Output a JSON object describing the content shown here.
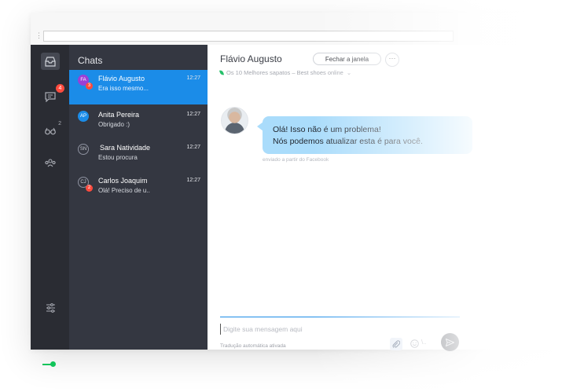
{
  "app": {
    "more_menu_glyph": "⋮"
  },
  "rail": {
    "items": [
      {
        "icon": "inbox-icon",
        "active": true
      },
      {
        "icon": "chat-bubble-icon",
        "badge": "4"
      },
      {
        "icon": "visitors-icon",
        "superscript": "2"
      },
      {
        "icon": "team-icon"
      },
      {
        "icon": "settings-sliders-icon"
      }
    ],
    "status_color": "#12c45a"
  },
  "chatlist": {
    "title": "Chats",
    "items": [
      {
        "initials": "FA",
        "name": "Flávio Augusto",
        "time": "12:27",
        "message": "Era isso mesmo...",
        "badge": "3",
        "active": true,
        "avatar_color": "#9b3fd6"
      },
      {
        "initials": "AP",
        "name": "Anita Pereira",
        "time": "12:27",
        "message": "Obrigado :)",
        "avatar_color": "#1b8ce8"
      },
      {
        "initials": "SN",
        "name": "Sara Natividade",
        "time": "12:27",
        "message": "Estou procura"
      },
      {
        "initials": "CJ",
        "name": "Carlos Joaquim",
        "time": "12:27",
        "message": "Olá! Preciso de u..",
        "badge": "2"
      }
    ]
  },
  "conversation": {
    "contact_name": "Flávio Augusto",
    "close_button": "Fechar a janela",
    "more_button": "···",
    "source": "Os 10 Melhores sapatos – Best shoes online",
    "messages": [
      {
        "lines": [
          "Olá! Isso não é um problema!",
          "Nós podemos atualizar esta é para você."
        ],
        "via": "enviado a partir do Facebook"
      }
    ],
    "compose_placeholder": "Digite sua mensagem aqui",
    "translation_note": "Tradução automática ativada",
    "slash_label": "\\..",
    "accent": "#1b8ce8",
    "bubble_color": "#aadcfb"
  }
}
